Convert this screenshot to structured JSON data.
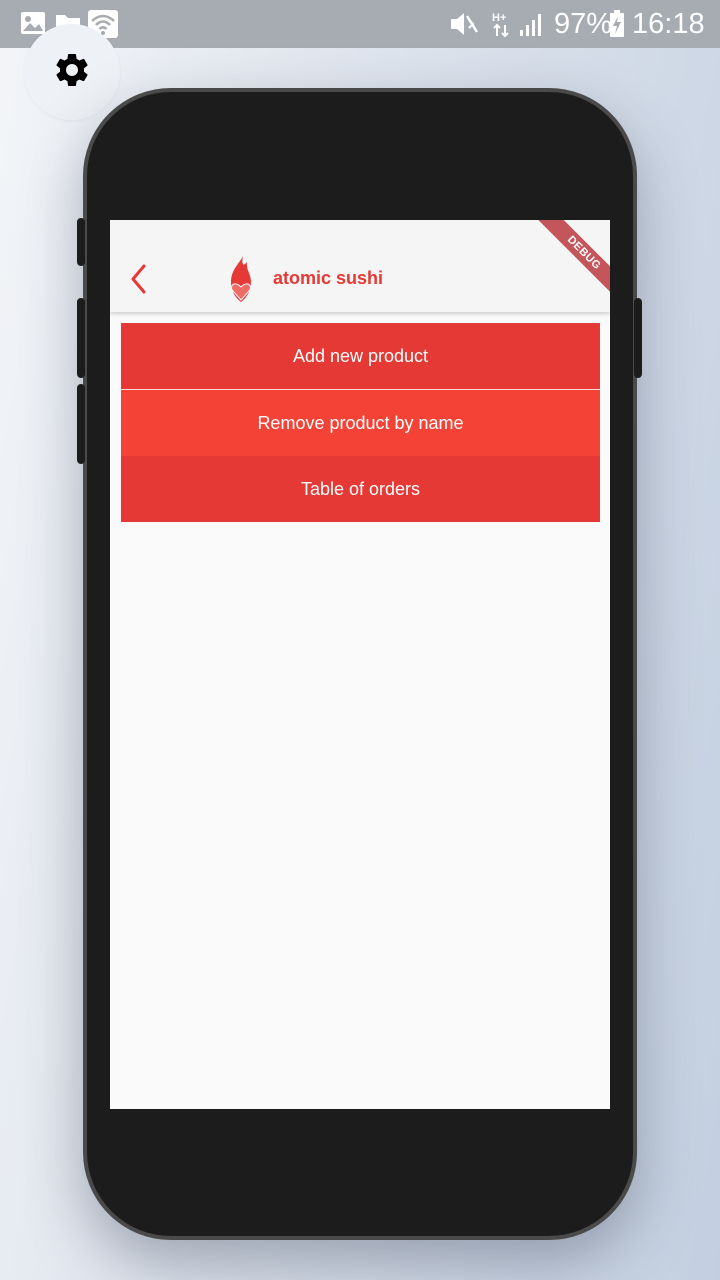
{
  "status_bar": {
    "battery": "97%",
    "time": "16:18",
    "icons": [
      "image-icon",
      "folder-icon",
      "wifi-icon",
      "vibrate-icon",
      "hplus-data-icon",
      "signal-icon",
      "battery-charging-icon"
    ]
  },
  "overlay": {
    "settings_icon": "gear-icon"
  },
  "app": {
    "title": "atomic sushi",
    "back_icon": "chevron-left-icon",
    "logo_icon": "flame-heart-icon",
    "debug_banner": "DEBUG",
    "accent_color": "#e53935"
  },
  "menu": {
    "items": [
      {
        "label": "Add new product"
      },
      {
        "label": "Remove product by name"
      },
      {
        "label": "Table of orders"
      }
    ]
  },
  "colors": {
    "primary": "#e53935",
    "primary_light": "#f44336",
    "screen_bg": "#fafafa",
    "phone_frame": "#1c1c1c"
  }
}
